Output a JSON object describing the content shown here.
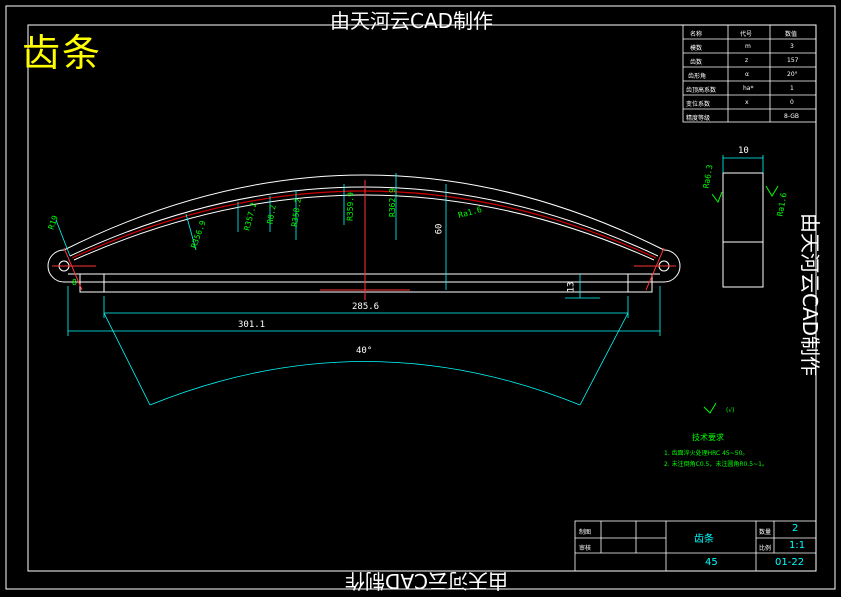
{
  "watermark": {
    "text": "由天河云CAD制作"
  },
  "part_title": "齿条",
  "params": {
    "rows": [
      [
        "名称",
        "代号",
        "数值"
      ],
      [
        "模数",
        "m",
        "3"
      ],
      [
        "齿数",
        "z",
        "157"
      ],
      [
        "齿形角",
        "α",
        "20°"
      ],
      [
        "齿顶高系数",
        "ha*",
        "1"
      ],
      [
        "变位系数",
        "x",
        "0"
      ],
      [
        "精度等级",
        "",
        "8-GB"
      ]
    ]
  },
  "dimensions": {
    "left_tag": "R19",
    "left_small": "8",
    "span_inner": "285.6",
    "span_outer": "301.1",
    "height": "60",
    "gap": "13",
    "angle": "40°",
    "side_width": "10",
    "radii": [
      "R356.9",
      "R357.2",
      "R0.2",
      "R358.2",
      "R359.9",
      "R362.9"
    ],
    "roughness_top": "Ra1.6",
    "roughness_side_left": "Ra6.3",
    "roughness_side_right": "Ra1.6",
    "roughness_note": "(√)"
  },
  "notes": {
    "heading": "技术要求",
    "lines": [
      "1. 齿面淬火处理HRC 45~50。",
      "2. 未注倒角C0.5，未注圆角R0.5~1。"
    ]
  },
  "titleblock": {
    "name": "齿条",
    "draw_label": "制图",
    "check_label": "审核",
    "qty_label": "数量",
    "qty": "2",
    "scale_label": "比例",
    "scale": "1:1",
    "material": "45",
    "drawing_no": "01-22"
  }
}
